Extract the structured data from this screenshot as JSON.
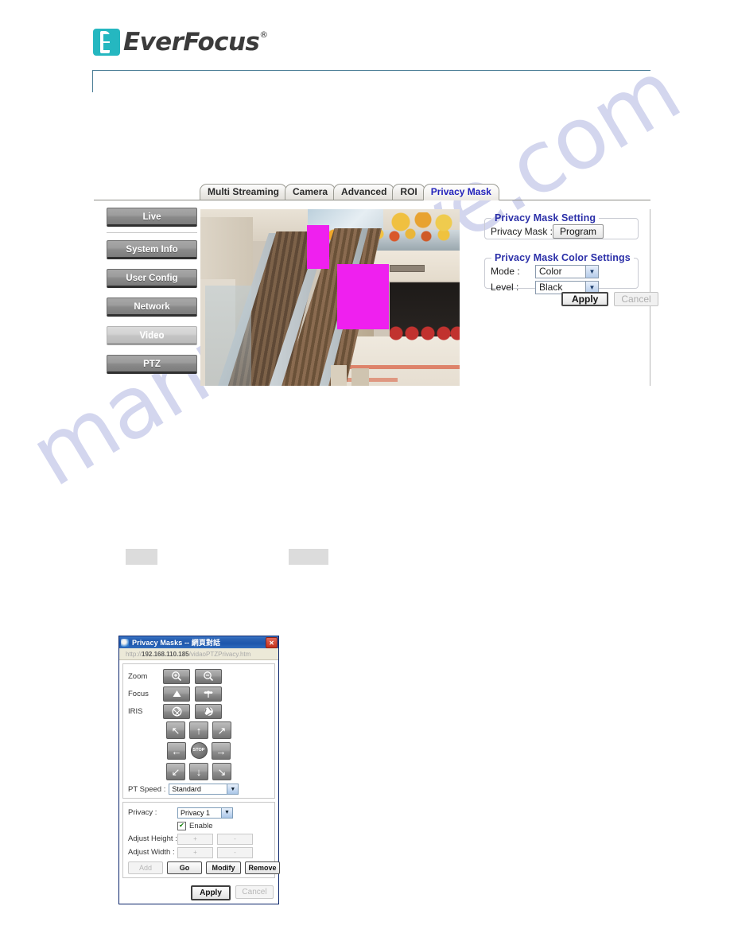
{
  "brand": {
    "name": "EverFocus",
    "registered": "®"
  },
  "watermark": {
    "text": "manualshive.com"
  },
  "webui": {
    "tabs": [
      {
        "label": "Multi Streaming",
        "active": false
      },
      {
        "label": "Camera",
        "active": false
      },
      {
        "label": "Advanced",
        "active": false
      },
      {
        "label": "ROI",
        "active": false
      },
      {
        "label": "Privacy Mask",
        "active": true
      }
    ],
    "sidebar": [
      {
        "label": "Live",
        "state": "normal"
      },
      {
        "label": "System Info",
        "state": "normal"
      },
      {
        "label": "User Config",
        "state": "normal"
      },
      {
        "label": "Network",
        "state": "normal"
      },
      {
        "label": "Video",
        "state": "selected"
      },
      {
        "label": "PTZ",
        "state": "normal"
      }
    ],
    "panel": {
      "setting_group": "Privacy Mask Setting",
      "privacy_mask_label": "Privacy Mask :",
      "program_button": "Program",
      "color_group": "Privacy Mask Color Settings",
      "mode_label": "Mode :",
      "mode_value": "Color",
      "level_label": "Level :",
      "level_value": "Black",
      "apply_button": "Apply",
      "cancel_button": "Cancel"
    },
    "preview": {
      "mask_color": "#ef20ef",
      "mask_count": 2
    }
  },
  "dialog": {
    "title": "Privacy Masks -- 網頁對話",
    "close_glyph": "✕",
    "url_prefix": "http://",
    "url_host": "192.168.110.185",
    "url_path": "/vidaoPTZPrivacy.htm",
    "zoom_label": "Zoom",
    "focus_label": "Focus",
    "iris_label": "IRIS",
    "stop_label": "STOP",
    "pt_speed_label": "PT Speed :",
    "pt_speed_value": "Standard",
    "privacy_label": "Privacy :",
    "privacy_value": "Privacy 1",
    "enable_label": "Enable",
    "enable_checked": "✔",
    "adjust_height_label": "Adjust Height :",
    "adjust_width_label": "Adjust Width :",
    "plus_label": "+",
    "minus_label": "-",
    "add_button": "Add",
    "go_button": "Go",
    "modify_button": "Modify",
    "remove_button": "Remove",
    "apply_button": "Apply",
    "cancel_button": "Cancel"
  }
}
